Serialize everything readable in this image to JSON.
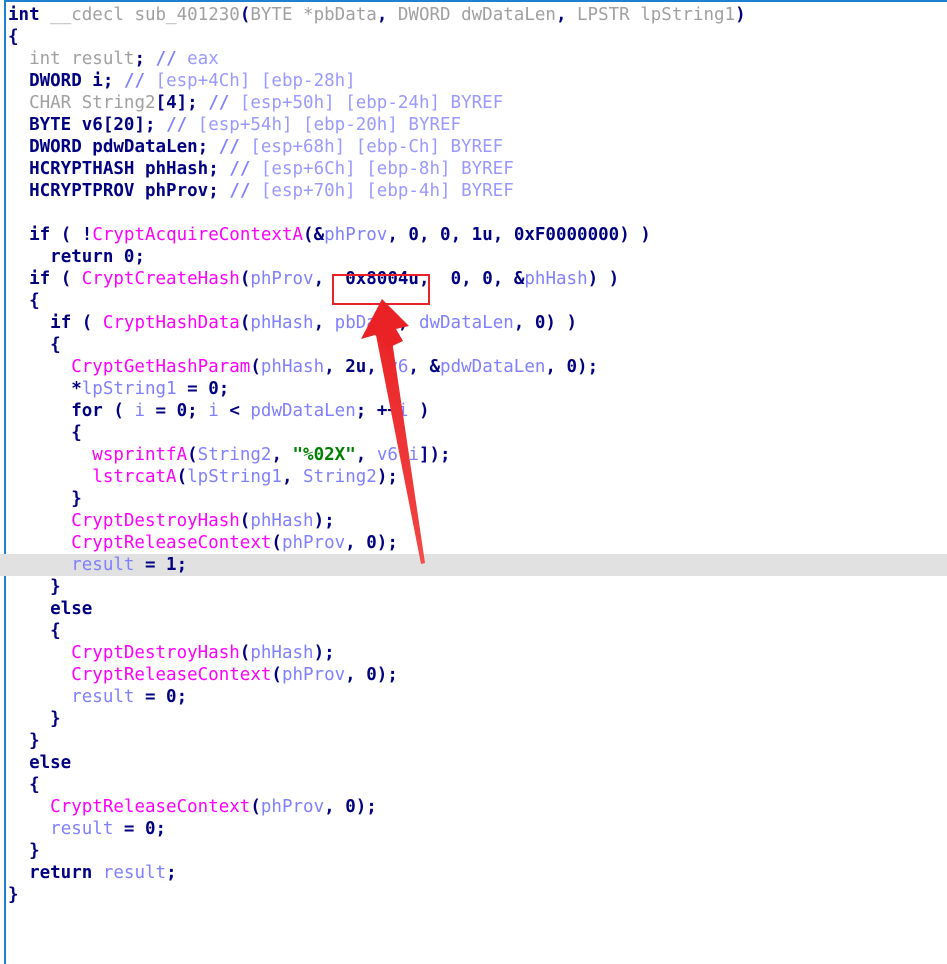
{
  "view": {
    "kind": "ida-hexrays-pseudocode",
    "background": "#ffffff",
    "panel_border_color": "#1f7fd0",
    "highlight_row_color": "#e1e1e1",
    "annotation_color": "#e8212b",
    "colors": {
      "keyword": "#000080",
      "api_function": "#ff00ff",
      "variable": "#8080ff",
      "comment": "#9999ff",
      "comment_type": "#a0a0a0",
      "string_literal": "#008000",
      "number": "#000080"
    }
  },
  "annotations": {
    "box_target_text": "0x8004u,",
    "arrow_name": "red-pointer-arrow",
    "arrow_points_to": "0x8004u,"
  },
  "code": {
    "signature": {
      "ret": "int",
      "conv": "__cdecl",
      "name": "sub_401230",
      "params": "(BYTE *pbData, DWORD dwDataLen, LPSTR lpString1)"
    },
    "lines": [
      {
        "indent": 0,
        "highlight": false,
        "tokens": [
          {
            "t": "int ",
            "c": "kw"
          },
          {
            "t": "__cdecl ",
            "c": "gray"
          },
          {
            "t": "sub_401230",
            "c": "gray"
          },
          {
            "t": "(",
            "c": "pun"
          },
          {
            "t": "BYTE ",
            "c": "gray"
          },
          {
            "t": "*pbData",
            "c": "gray"
          },
          {
            "t": ", ",
            "c": "pun"
          },
          {
            "t": "DWORD ",
            "c": "gray"
          },
          {
            "t": "dwDataLen",
            "c": "gray"
          },
          {
            "t": ", ",
            "c": "pun"
          },
          {
            "t": "LPSTR ",
            "c": "gray"
          },
          {
            "t": "lpString1",
            "c": "gray"
          },
          {
            "t": ")",
            "c": "pun"
          }
        ]
      },
      {
        "indent": 0,
        "highlight": false,
        "tokens": [
          {
            "t": "{",
            "c": "pun"
          }
        ]
      },
      {
        "indent": 1,
        "highlight": false,
        "tokens": [
          {
            "t": "int ",
            "c": "gray"
          },
          {
            "t": "result",
            "c": "gray"
          },
          {
            "t": "; ",
            "c": "pun"
          },
          {
            "t": "// ",
            "c": "cmtslash"
          },
          {
            "t": "eax",
            "c": "cmt"
          }
        ]
      },
      {
        "indent": 1,
        "highlight": false,
        "tokens": [
          {
            "t": "DWORD ",
            "c": "kw"
          },
          {
            "t": "i",
            "c": "kw"
          },
          {
            "t": "; ",
            "c": "pun"
          },
          {
            "t": "// ",
            "c": "cmtslash"
          },
          {
            "t": "[esp+4Ch] [ebp-28h]",
            "c": "cmt"
          }
        ]
      },
      {
        "indent": 1,
        "highlight": false,
        "tokens": [
          {
            "t": "CHAR ",
            "c": "gray"
          },
          {
            "t": "String2",
            "c": "gray"
          },
          {
            "t": "[4]",
            "c": "pun"
          },
          {
            "t": "; ",
            "c": "pun"
          },
          {
            "t": "// ",
            "c": "cmtslash"
          },
          {
            "t": "[esp+50h] [ebp-24h] BYREF",
            "c": "cmt"
          }
        ]
      },
      {
        "indent": 1,
        "highlight": false,
        "tokens": [
          {
            "t": "BYTE ",
            "c": "kw"
          },
          {
            "t": "v6",
            "c": "kw"
          },
          {
            "t": "[20]",
            "c": "pun"
          },
          {
            "t": "; ",
            "c": "pun"
          },
          {
            "t": "// ",
            "c": "cmtslash"
          },
          {
            "t": "[esp+54h] [ebp-20h] BYREF",
            "c": "cmt"
          }
        ]
      },
      {
        "indent": 1,
        "highlight": false,
        "tokens": [
          {
            "t": "DWORD ",
            "c": "kw"
          },
          {
            "t": "pdwDataLen",
            "c": "kw"
          },
          {
            "t": "; ",
            "c": "pun"
          },
          {
            "t": "// ",
            "c": "cmtslash"
          },
          {
            "t": "[esp+68h] [ebp-Ch] BYREF",
            "c": "cmt"
          }
        ]
      },
      {
        "indent": 1,
        "highlight": false,
        "tokens": [
          {
            "t": "HCRYPTHASH ",
            "c": "kw"
          },
          {
            "t": "phHash",
            "c": "kw"
          },
          {
            "t": "; ",
            "c": "pun"
          },
          {
            "t": "// ",
            "c": "cmtslash"
          },
          {
            "t": "[esp+6Ch] [ebp-8h] BYREF",
            "c": "cmt"
          }
        ]
      },
      {
        "indent": 1,
        "highlight": false,
        "tokens": [
          {
            "t": "HCRYPTPROV ",
            "c": "kw"
          },
          {
            "t": "phProv",
            "c": "kw"
          },
          {
            "t": "; ",
            "c": "pun"
          },
          {
            "t": "// ",
            "c": "cmtslash"
          },
          {
            "t": "[esp+70h] [ebp-4h] BYREF",
            "c": "cmt"
          }
        ]
      },
      {
        "indent": 0,
        "highlight": false,
        "tokens": []
      },
      {
        "indent": 1,
        "highlight": false,
        "tokens": [
          {
            "t": "if ",
            "c": "kw"
          },
          {
            "t": "( ",
            "c": "pun"
          },
          {
            "t": "!",
            "c": "pun"
          },
          {
            "t": "CryptAcquireContextA",
            "c": "fn"
          },
          {
            "t": "(",
            "c": "pun"
          },
          {
            "t": "&",
            "c": "pun"
          },
          {
            "t": "phProv",
            "c": "var"
          },
          {
            "t": ", ",
            "c": "pun"
          },
          {
            "t": "0",
            "c": "num"
          },
          {
            "t": ", ",
            "c": "pun"
          },
          {
            "t": "0",
            "c": "num"
          },
          {
            "t": ", ",
            "c": "pun"
          },
          {
            "t": "1u",
            "c": "num"
          },
          {
            "t": ", ",
            "c": "pun"
          },
          {
            "t": "0xF0000000",
            "c": "num"
          },
          {
            "t": ") )",
            "c": "pun"
          }
        ]
      },
      {
        "indent": 2,
        "highlight": false,
        "tokens": [
          {
            "t": "return ",
            "c": "kw"
          },
          {
            "t": "0",
            "c": "num"
          },
          {
            "t": ";",
            "c": "pun"
          }
        ]
      },
      {
        "indent": 1,
        "highlight": false,
        "tokens": [
          {
            "t": "if ",
            "c": "kw"
          },
          {
            "t": "( ",
            "c": "pun"
          },
          {
            "t": "CryptCreateHash",
            "c": "fn"
          },
          {
            "t": "(",
            "c": "pun"
          },
          {
            "t": "phProv",
            "c": "var"
          },
          {
            "t": ", ",
            "c": "pun"
          },
          {
            "t": " ",
            "c": "pun"
          },
          {
            "t": "0x8004u",
            "c": "num"
          },
          {
            "t": ", ",
            "c": "pun"
          },
          {
            "t": " ",
            "c": "pun"
          },
          {
            "t": "0",
            "c": "num"
          },
          {
            "t": ", ",
            "c": "pun"
          },
          {
            "t": "0",
            "c": "num"
          },
          {
            "t": ", ",
            "c": "pun"
          },
          {
            "t": "&",
            "c": "pun"
          },
          {
            "t": "phHash",
            "c": "var"
          },
          {
            "t": ") )",
            "c": "pun"
          }
        ]
      },
      {
        "indent": 1,
        "highlight": false,
        "tokens": [
          {
            "t": "{",
            "c": "pun"
          }
        ]
      },
      {
        "indent": 2,
        "highlight": false,
        "tokens": [
          {
            "t": "if ",
            "c": "kw"
          },
          {
            "t": "( ",
            "c": "pun"
          },
          {
            "t": "CryptHashData",
            "c": "fn"
          },
          {
            "t": "(",
            "c": "pun"
          },
          {
            "t": "phHash",
            "c": "var"
          },
          {
            "t": ", ",
            "c": "pun"
          },
          {
            "t": "pbData",
            "c": "var"
          },
          {
            "t": ", ",
            "c": "pun"
          },
          {
            "t": "dwDataLen",
            "c": "var"
          },
          {
            "t": ", ",
            "c": "pun"
          },
          {
            "t": "0",
            "c": "num"
          },
          {
            "t": ") )",
            "c": "pun"
          }
        ]
      },
      {
        "indent": 2,
        "highlight": false,
        "tokens": [
          {
            "t": "{",
            "c": "pun"
          }
        ]
      },
      {
        "indent": 3,
        "highlight": false,
        "tokens": [
          {
            "t": "CryptGetHashParam",
            "c": "fn"
          },
          {
            "t": "(",
            "c": "pun"
          },
          {
            "t": "phHash",
            "c": "var"
          },
          {
            "t": ", ",
            "c": "pun"
          },
          {
            "t": "2u",
            "c": "num"
          },
          {
            "t": ", ",
            "c": "pun"
          },
          {
            "t": "v6",
            "c": "var"
          },
          {
            "t": ", ",
            "c": "pun"
          },
          {
            "t": "&",
            "c": "pun"
          },
          {
            "t": "pdwDataLen",
            "c": "var"
          },
          {
            "t": ", ",
            "c": "pun"
          },
          {
            "t": "0",
            "c": "num"
          },
          {
            "t": ");",
            "c": "pun"
          }
        ]
      },
      {
        "indent": 3,
        "highlight": false,
        "tokens": [
          {
            "t": "*",
            "c": "pun"
          },
          {
            "t": "lpString1",
            "c": "var"
          },
          {
            "t": " = ",
            "c": "pun"
          },
          {
            "t": "0",
            "c": "num"
          },
          {
            "t": ";",
            "c": "pun"
          }
        ]
      },
      {
        "indent": 3,
        "highlight": false,
        "tokens": [
          {
            "t": "for ",
            "c": "kw"
          },
          {
            "t": "( ",
            "c": "pun"
          },
          {
            "t": "i",
            "c": "var"
          },
          {
            "t": " = ",
            "c": "pun"
          },
          {
            "t": "0",
            "c": "num"
          },
          {
            "t": "; ",
            "c": "pun"
          },
          {
            "t": "i",
            "c": "var"
          },
          {
            "t": " < ",
            "c": "pun"
          },
          {
            "t": "pdwDataLen",
            "c": "var"
          },
          {
            "t": "; ",
            "c": "pun"
          },
          {
            "t": "++",
            "c": "pun"
          },
          {
            "t": "i",
            "c": "var"
          },
          {
            "t": " )",
            "c": "pun"
          }
        ]
      },
      {
        "indent": 3,
        "highlight": false,
        "tokens": [
          {
            "t": "{",
            "c": "pun"
          }
        ]
      },
      {
        "indent": 4,
        "highlight": false,
        "tokens": [
          {
            "t": "wsprintfA",
            "c": "fn"
          },
          {
            "t": "(",
            "c": "pun"
          },
          {
            "t": "String2",
            "c": "var"
          },
          {
            "t": ", ",
            "c": "pun"
          },
          {
            "t": "\"%02X\"",
            "c": "str"
          },
          {
            "t": ", ",
            "c": "pun"
          },
          {
            "t": "v6",
            "c": "var"
          },
          {
            "t": "[",
            "c": "pun"
          },
          {
            "t": "i",
            "c": "var"
          },
          {
            "t": "]);",
            "c": "pun"
          }
        ]
      },
      {
        "indent": 4,
        "highlight": false,
        "tokens": [
          {
            "t": "lstrcatA",
            "c": "fn"
          },
          {
            "t": "(",
            "c": "pun"
          },
          {
            "t": "lpString1",
            "c": "var"
          },
          {
            "t": ", ",
            "c": "pun"
          },
          {
            "t": "String2",
            "c": "var"
          },
          {
            "t": ");",
            "c": "pun"
          }
        ]
      },
      {
        "indent": 3,
        "highlight": false,
        "tokens": [
          {
            "t": "}",
            "c": "pun"
          }
        ]
      },
      {
        "indent": 3,
        "highlight": false,
        "tokens": [
          {
            "t": "CryptDestroyHash",
            "c": "fn"
          },
          {
            "t": "(",
            "c": "pun"
          },
          {
            "t": "phHash",
            "c": "var"
          },
          {
            "t": ");",
            "c": "pun"
          }
        ]
      },
      {
        "indent": 3,
        "highlight": false,
        "tokens": [
          {
            "t": "CryptReleaseContext",
            "c": "fn"
          },
          {
            "t": "(",
            "c": "pun"
          },
          {
            "t": "phProv",
            "c": "var"
          },
          {
            "t": ", ",
            "c": "pun"
          },
          {
            "t": "0",
            "c": "num"
          },
          {
            "t": ");",
            "c": "pun"
          }
        ]
      },
      {
        "indent": 3,
        "highlight": true,
        "tokens": [
          {
            "t": "result",
            "c": "var"
          },
          {
            "t": " = ",
            "c": "pun"
          },
          {
            "t": "1",
            "c": "num"
          },
          {
            "t": ";",
            "c": "pun"
          }
        ]
      },
      {
        "indent": 2,
        "highlight": false,
        "tokens": [
          {
            "t": "}",
            "c": "pun"
          }
        ]
      },
      {
        "indent": 2,
        "highlight": false,
        "tokens": [
          {
            "t": "else",
            "c": "kw"
          }
        ]
      },
      {
        "indent": 2,
        "highlight": false,
        "tokens": [
          {
            "t": "{",
            "c": "pun"
          }
        ]
      },
      {
        "indent": 3,
        "highlight": false,
        "tokens": [
          {
            "t": "CryptDestroyHash",
            "c": "fn"
          },
          {
            "t": "(",
            "c": "pun"
          },
          {
            "t": "phHash",
            "c": "var"
          },
          {
            "t": ");",
            "c": "pun"
          }
        ]
      },
      {
        "indent": 3,
        "highlight": false,
        "tokens": [
          {
            "t": "CryptReleaseContext",
            "c": "fn"
          },
          {
            "t": "(",
            "c": "pun"
          },
          {
            "t": "phProv",
            "c": "var"
          },
          {
            "t": ", ",
            "c": "pun"
          },
          {
            "t": "0",
            "c": "num"
          },
          {
            "t": ");",
            "c": "pun"
          }
        ]
      },
      {
        "indent": 3,
        "highlight": false,
        "tokens": [
          {
            "t": "result",
            "c": "var"
          },
          {
            "t": " = ",
            "c": "pun"
          },
          {
            "t": "0",
            "c": "num"
          },
          {
            "t": ";",
            "c": "pun"
          }
        ]
      },
      {
        "indent": 2,
        "highlight": false,
        "tokens": [
          {
            "t": "}",
            "c": "pun"
          }
        ]
      },
      {
        "indent": 1,
        "highlight": false,
        "tokens": [
          {
            "t": "}",
            "c": "pun"
          }
        ]
      },
      {
        "indent": 1,
        "highlight": false,
        "tokens": [
          {
            "t": "else",
            "c": "kw"
          }
        ]
      },
      {
        "indent": 1,
        "highlight": false,
        "tokens": [
          {
            "t": "{",
            "c": "pun"
          }
        ]
      },
      {
        "indent": 2,
        "highlight": false,
        "tokens": [
          {
            "t": "CryptReleaseContext",
            "c": "fn"
          },
          {
            "t": "(",
            "c": "pun"
          },
          {
            "t": "phProv",
            "c": "var"
          },
          {
            "t": ", ",
            "c": "pun"
          },
          {
            "t": "0",
            "c": "num"
          },
          {
            "t": ");",
            "c": "pun"
          }
        ]
      },
      {
        "indent": 2,
        "highlight": false,
        "tokens": [
          {
            "t": "result",
            "c": "var"
          },
          {
            "t": " = ",
            "c": "pun"
          },
          {
            "t": "0",
            "c": "num"
          },
          {
            "t": ";",
            "c": "pun"
          }
        ]
      },
      {
        "indent": 1,
        "highlight": false,
        "tokens": [
          {
            "t": "}",
            "c": "pun"
          }
        ]
      },
      {
        "indent": 1,
        "highlight": false,
        "tokens": [
          {
            "t": "return ",
            "c": "kw"
          },
          {
            "t": "result",
            "c": "var"
          },
          {
            "t": ";",
            "c": "pun"
          }
        ]
      },
      {
        "indent": 0,
        "highlight": false,
        "tokens": [
          {
            "t": "}",
            "c": "pun"
          }
        ]
      }
    ]
  }
}
